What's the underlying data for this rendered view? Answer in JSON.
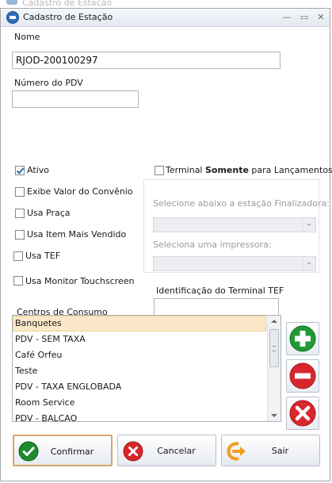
{
  "window": {
    "title": "Cadastro de Estação",
    "background_title": "Cadastro de Estação"
  },
  "form": {
    "nome_label": "Nome",
    "nome_value": "RJOD-200100297",
    "numero_pdv_label": "Número do PDV",
    "numero_pdv_value": ""
  },
  "checkboxes": {
    "ativo": {
      "label": "Ativo",
      "checked": true
    },
    "exibe_valor": {
      "label": "Exibe Valor do Convênio",
      "checked": false
    },
    "usa_praca": {
      "label": "Usa Praça",
      "checked": false
    },
    "usa_item": {
      "label": "Usa Item Mais Vendido",
      "checked": false
    },
    "usa_tef": {
      "label": "Usa TEF",
      "checked": false
    },
    "usa_monitor": {
      "label": "Usa Monitor Touchscreen",
      "checked": false
    },
    "terminal": {
      "label_pre": "Terminal ",
      "label_bold": "Somente",
      "label_post": " para Lançamentos",
      "checked": false
    }
  },
  "group": {
    "finalizadora_label": "Selecione abaixo a estação Finalizadora:",
    "finalizadora_value": "",
    "impressora_label": "Seleciona uma impressora:",
    "impressora_value": ""
  },
  "tef": {
    "label": "Identificação do Terminal TEF",
    "value": ""
  },
  "centros": {
    "label": "Centros de Consumo",
    "items": [
      "Banquetes",
      "PDV - SEM TAXA",
      "Café Orfeu",
      "Teste",
      "PDV - TAXA ENGLOBADA",
      "Room Service",
      "PDV - BALCAO"
    ],
    "selected_index": 0
  },
  "side_buttons": {
    "add_icon": "plus-circle-icon",
    "remove_icon": "minus-circle-icon",
    "clear_icon": "x-circle-icon"
  },
  "buttons": {
    "confirmar": "Confirmar",
    "cancelar": "Cancelar",
    "sair": "Sair"
  },
  "colors": {
    "add": "#1f9a36",
    "remove": "#d8262c",
    "confirm_check": "#1f8a2e",
    "sair": "#f39c1f"
  }
}
